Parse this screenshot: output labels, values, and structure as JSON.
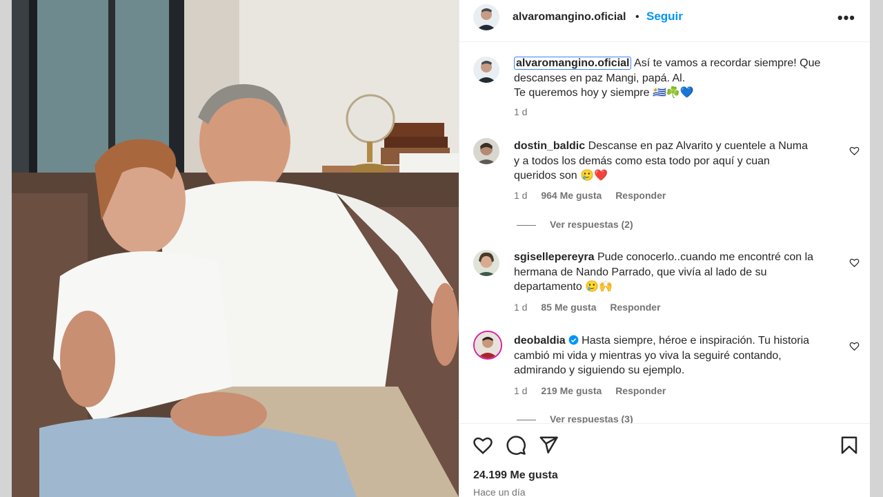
{
  "post": {
    "author": "alvaromangino.oficial",
    "separator": "•",
    "follow_label": "Seguir",
    "more_label": "•••"
  },
  "caption": {
    "username": "alvaromangino.oficial",
    "text_line1": "Así te vamos a recordar siempre! Que",
    "text_line2": "descanses en paz Mangi, papá. Al.",
    "text_line3": "Te queremos hoy y siempre 🇺🇾☘️💙",
    "time": "1 d"
  },
  "comments": [
    {
      "username": "dostin_baldic",
      "text_line1": "Descanse en paz Alvarito y cuentele a Numa",
      "text_line2": "y a todos los demás como esta todo por aquí y cuan",
      "text_line3": "queridos son 🥲❤️",
      "time": "1 d",
      "likes": "964 Me gusta",
      "reply_label": "Responder",
      "view_replies": "Ver respuestas (2)"
    },
    {
      "username": "sgisellepereyra",
      "text_line1": "Pude conocerlo..cuando me encontré con la",
      "text_line2": "hermana de Nando Parrado, que vivía al lado de su",
      "text_line3": "departamento 🥲🙌",
      "time": "1 d",
      "likes": "85 Me gusta",
      "reply_label": "Responder"
    },
    {
      "username": "deobaldia",
      "text_line1": "Hasta siempre, héroe e inspiración. Tu historia",
      "text_line2": "cambió mi vida y mientras yo viva la seguiré contando,",
      "text_line3": "admirando y siguiendo su ejemplo.",
      "time": "1 d",
      "likes": "219 Me gusta",
      "reply_label": "Responder",
      "view_replies": "Ver respuestas (3)"
    }
  ],
  "footer": {
    "likes": "24.199 Me gusta",
    "time_ago": "Hace un día"
  },
  "colors": {
    "accent": "#0095f6",
    "verified": "#0095f6",
    "muted": "#737373"
  },
  "icons": [
    "heart-icon",
    "comment-icon",
    "share-icon",
    "bookmark-icon",
    "more-icon",
    "verified-icon"
  ]
}
